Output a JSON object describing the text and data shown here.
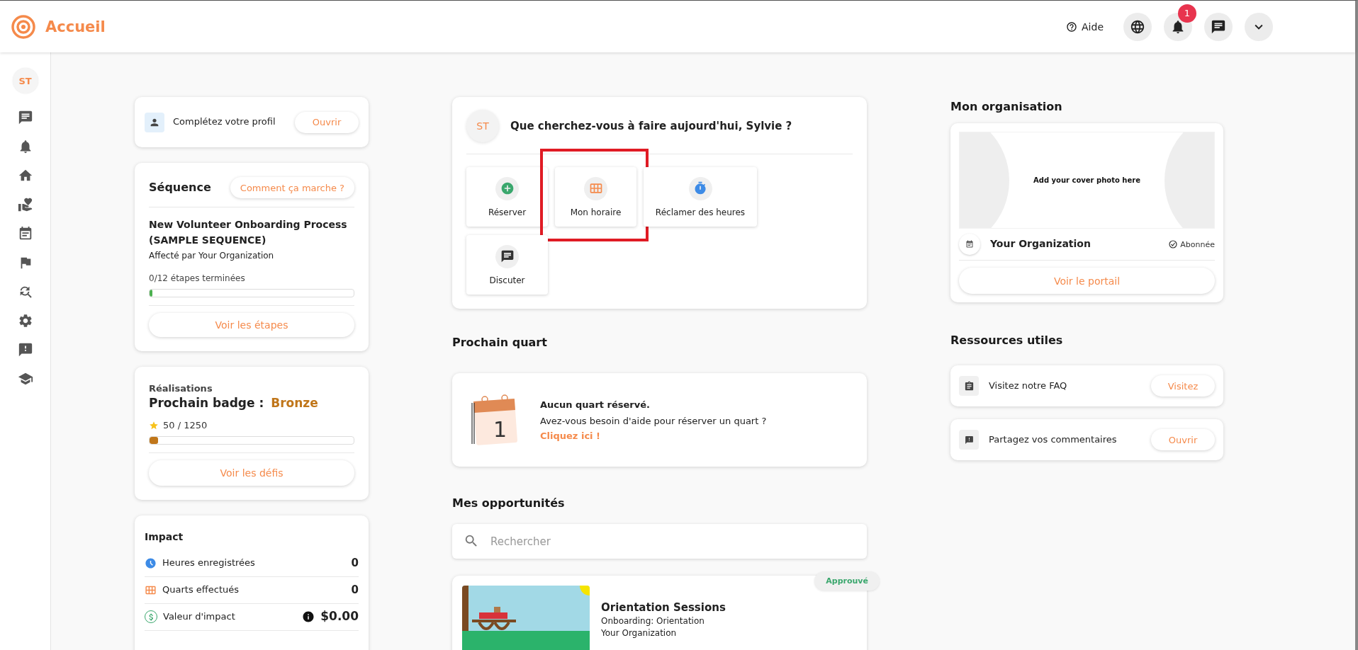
{
  "header": {
    "title": "Accueil",
    "help": "Aide",
    "notification_count": "1"
  },
  "sidebar": {
    "avatar": "ST"
  },
  "profile_card": {
    "text": "Complétez votre profil",
    "button": "Ouvrir"
  },
  "sequence": {
    "title": "Séquence",
    "help_button": "Comment ça marche ?",
    "name": "New Volunteer Onboarding Process (SAMPLE SEQUENCE)",
    "assigned": "Affecté par Your Organization",
    "progress_text": "0/12 étapes terminées",
    "level": 0.01,
    "button": "Voir les étapes"
  },
  "achievements": {
    "label": "Réalisations",
    "next_badge_label": "Prochain badge :",
    "badge": "Bronze",
    "points": "50 / 1250",
    "level": 0.04,
    "button": "Voir les défis"
  },
  "impact": {
    "title": "Impact",
    "rows": [
      {
        "kind": "hours",
        "label": "Heures enregistrées",
        "value": "0"
      },
      {
        "kind": "shifts",
        "label": "Quarts effectués",
        "value": "0"
      },
      {
        "kind": "money",
        "label": "Valeur d'impact",
        "value": "$0.00"
      }
    ]
  },
  "welcome": {
    "avatar": "ST",
    "question": "Que cherchez-vous à faire aujourd'hui, Sylvie ?",
    "actions": [
      {
        "kind": "book",
        "label": "Réserver",
        "highlighted": false
      },
      {
        "kind": "schedule",
        "label": "Mon horaire",
        "highlighted": true
      },
      {
        "kind": "claim",
        "label": "Réclamer des heures",
        "highlighted": false
      },
      {
        "kind": "chat",
        "label": "Discuter",
        "highlighted": false
      }
    ]
  },
  "next_shift": {
    "heading": "Prochain quart",
    "illustration_day": "1",
    "title": "Aucun quart réservé.",
    "text": "Avez-vous besoin d'aide pour réserver un quart ?",
    "link": "Cliquez ici !"
  },
  "opportunities": {
    "heading": "Mes opportunités",
    "search": {
      "placeholder": "Rechercher"
    },
    "items": [
      {
        "title": "Orientation Sessions",
        "category": "Onboarding: Orientation",
        "organization": "Your Organization",
        "status": "Approuvé"
      }
    ]
  },
  "organization": {
    "heading": "Mon organisation",
    "cover_text": "Add your cover photo here",
    "name": "Your Organization",
    "subscribed": true,
    "subscribed_label": "Abonnée",
    "button": "Voir le portail"
  },
  "resources": {
    "heading": "Ressources utiles",
    "items": [
      {
        "kind": "faq",
        "label": "Visitez notre FAQ",
        "button": "Visitez"
      },
      {
        "kind": "feedback",
        "label": "Partagez vos commentaires",
        "button": "Ouvrir"
      }
    ]
  }
}
